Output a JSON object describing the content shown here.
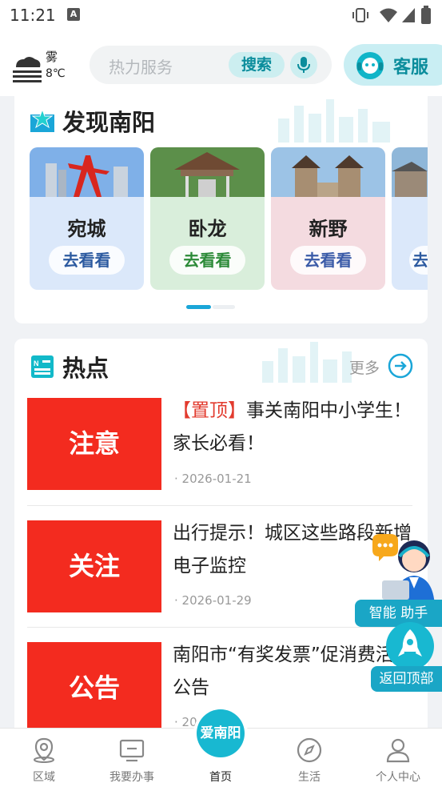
{
  "status_bar": {
    "time": "11:21"
  },
  "header": {
    "weather": {
      "condition": "雾",
      "temp": "8℃"
    },
    "search": {
      "placeholder": "热力服务",
      "button": "搜索"
    },
    "service_label": "客服"
  },
  "discover": {
    "title": "发现南阳",
    "cities": [
      {
        "name": "宛城",
        "action": "去看看",
        "bg": "#dbe8fa",
        "accent": "#2c5aa0"
      },
      {
        "name": "卧龙",
        "action": "去看看",
        "bg": "#d9eedb",
        "accent": "#2c8a38"
      },
      {
        "name": "新野",
        "action": "去看看",
        "bg": "#f4dbe0",
        "accent": "#3b5ba8"
      },
      {
        "name": "",
        "action": "去",
        "bg": "#dbe8fa",
        "accent": "#2c5aa0"
      }
    ]
  },
  "hot": {
    "title": "热点",
    "more": "更多",
    "items": [
      {
        "image_text": "注意",
        "tag": "【置顶】",
        "title": "事关南阳中小学生！家长必看！",
        "date": "· 2026-01-21"
      },
      {
        "image_text": "关注",
        "tag": "",
        "title": "出行提示！城区这些路段新增电子监控",
        "date": "· 2026-01-29"
      },
      {
        "image_text": "公告",
        "tag": "",
        "title": "南阳市“有奖发票”促消费活动公告",
        "date": "· 20"
      }
    ]
  },
  "floating": {
    "assistant_label": "智能 助手",
    "back_to_top_label": "返回顶部"
  },
  "tabbar": {
    "center_logo": "爱南阳",
    "tabs": [
      {
        "label": "区域",
        "icon": "location-pin-icon"
      },
      {
        "label": "我要办事",
        "icon": "monitor-icon"
      },
      {
        "label": "首页",
        "icon": "home-logo-icon"
      },
      {
        "label": "生活",
        "icon": "compass-icon"
      },
      {
        "label": "个人中心",
        "icon": "person-icon"
      }
    ]
  },
  "colors": {
    "accent": "#0b8d9c",
    "red": "#f32b1f",
    "tag_red": "#e23b2e"
  }
}
